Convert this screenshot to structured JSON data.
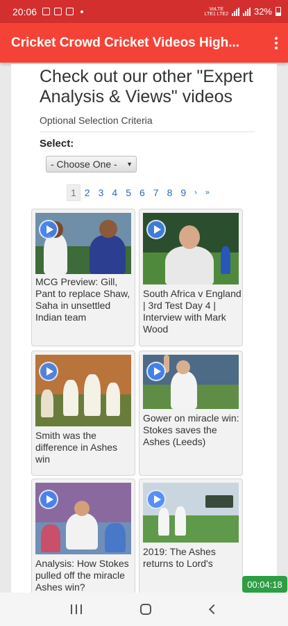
{
  "status_bar": {
    "time": "20:06",
    "network_label_top": "VoLTE",
    "network_label_bottom": "LTE1 LTE2",
    "battery": "32%"
  },
  "app_bar": {
    "title": "Cricket Crowd Cricket Videos High...",
    "menu_icon": "overflow-menu-icon"
  },
  "page": {
    "heading": "Check out our other \"Expert Analysis & Views\" videos",
    "optional_label": "Optional Selection Criteria",
    "select_label": "Select:",
    "select_value": "- Choose One -"
  },
  "pagination": {
    "pages": [
      "1",
      "2",
      "3",
      "4",
      "5",
      "6",
      "7",
      "8",
      "9"
    ],
    "active_page": "1",
    "next": "›",
    "last": "»"
  },
  "videos": [
    {
      "title": "MCG Preview: Gill, Pant to replace Shaw, Saha in unsettled Indian team"
    },
    {
      "title": "South Africa v England | 3rd Test Day 4 | Interview with Mark Wood"
    },
    {
      "title": "Smith was the difference in Ashes win"
    },
    {
      "title": "Gower on miracle win: Stokes saves the Ashes (Leeds)"
    },
    {
      "title": "Analysis: How Stokes pulled off the miracle Ashes win?"
    },
    {
      "title": "2019: The Ashes returns to Lord's"
    }
  ],
  "timer": "00:04:18",
  "colors": {
    "status_bar": "#d32f2f",
    "app_bar": "#f44336",
    "link": "#2a6ebb",
    "play_button": "#4285f4",
    "timer_bg": "#2e9e45"
  }
}
